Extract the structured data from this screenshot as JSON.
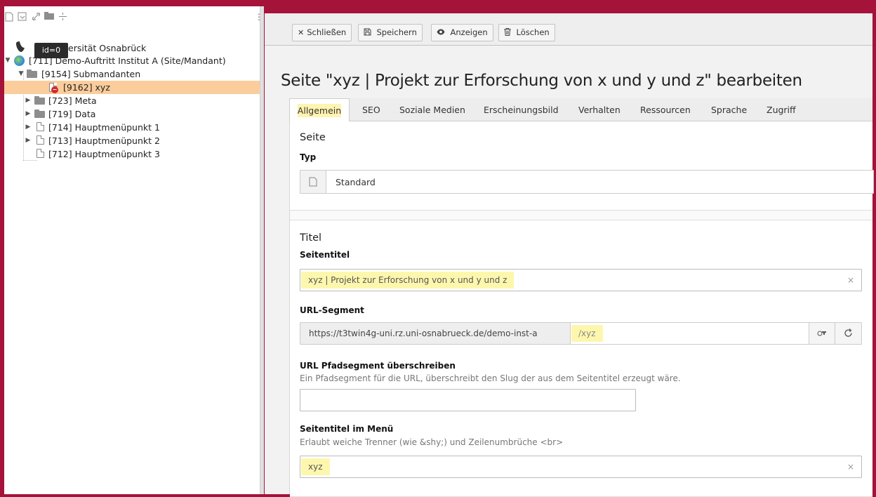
{
  "tree": {
    "tooltip": "id=0",
    "root_label": "ersität Osnabrück",
    "nodes": [
      {
        "label": "[711] Demo-Auftritt Institut A (Site/Mandant)"
      },
      {
        "label": "[9154] Submandanten"
      },
      {
        "label": "[9162] xyz"
      },
      {
        "label": "[723] Meta"
      },
      {
        "label": "[719] Data"
      },
      {
        "label": "[714] Hauptmenüpunkt 1"
      },
      {
        "label": "[713] Hauptmenüpunkt 2"
      },
      {
        "label": "[712] Hauptmenüpunkt 3"
      }
    ]
  },
  "toolbar": {
    "close_label": "Schließen",
    "save_label": "Speichern",
    "view_label": "Anzeigen",
    "delete_label": "Löschen"
  },
  "page_title": "Seite \"xyz | Projekt zur Erforschung von x und y und z\" bearbeiten",
  "tabs": [
    "Allgemein",
    "SEO",
    "Soziale Medien",
    "Erscheinungsbild",
    "Verhalten",
    "Ressourcen",
    "Sprache",
    "Zugriff"
  ],
  "section_page": {
    "title": "Seite",
    "type_label": "Typ",
    "type_value": "Standard"
  },
  "section_title": {
    "title": "Titel",
    "seitentitel_label": "Seitentitel",
    "seitentitel_value": "xyz | Projekt zur Erforschung von x und y und z",
    "url_label": "URL-Segment",
    "url_prefix": "https://t3twin4g-uni.rz.uni-osnabrueck.de/demo-inst-a",
    "url_value": "/xyz",
    "override_label": "URL Pfadsegment überschreiben",
    "override_desc": "Ein Pfadsegment für die URL, überschreibt den Slug der aus dem Seitentitel erzeugt wäre.",
    "override_value": "",
    "menu_label": "Seitentitel im Menü",
    "menu_desc": "Erlaubt weiche Trenner (wie &shy;) und Zeilenumbrüche <br>",
    "menu_value": "xyz"
  },
  "icons": {
    "clear": "×",
    "close": "×"
  },
  "colors": {
    "frame": "#a5123a",
    "selected_row": "#fbcd9c",
    "highlight": "#fdf7ae"
  }
}
